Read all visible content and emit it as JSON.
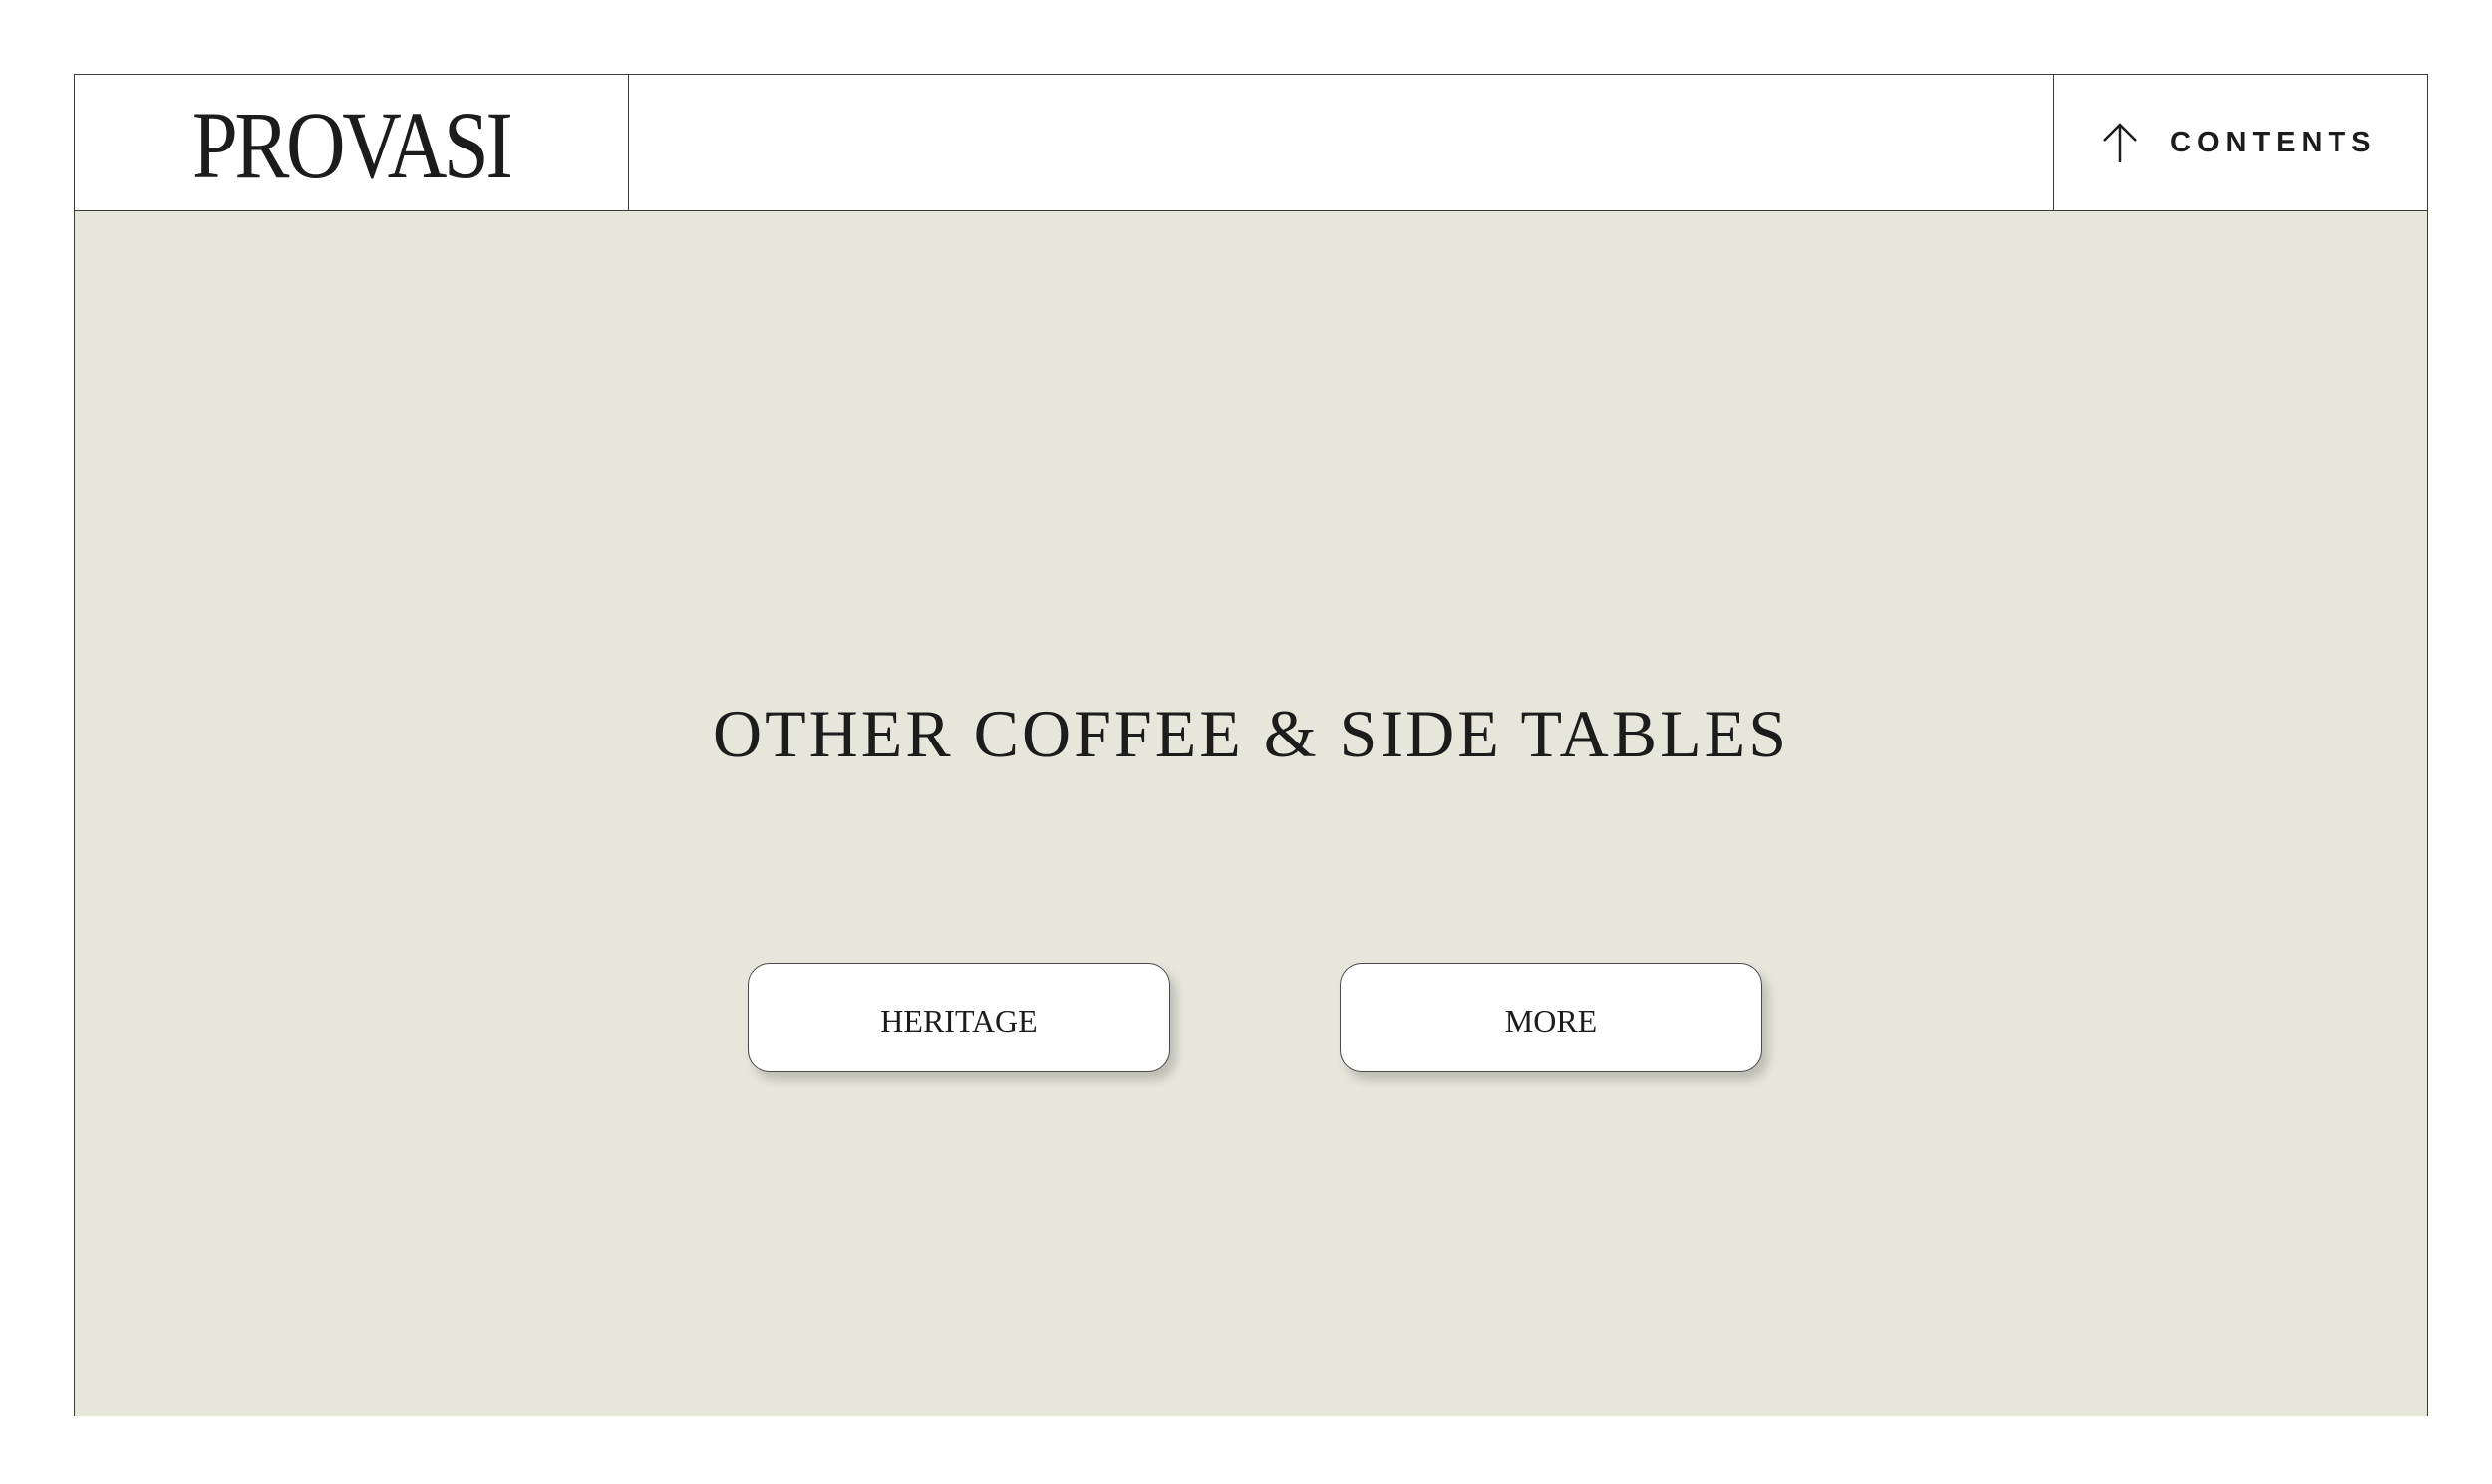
{
  "header": {
    "logo_text": "PROVASI",
    "contents_label": "CONTENTS",
    "contents_icon": "arrow-up-icon"
  },
  "main": {
    "title": "OTHER COFFEE & SIDE TABLES",
    "buttons": [
      {
        "label": "HERITAGE"
      },
      {
        "label": "MORE"
      }
    ]
  },
  "colors": {
    "background": "#ffffff",
    "hero_background": "#e6e6db",
    "text": "#1c1c1c",
    "border": "#3a3a3a"
  }
}
